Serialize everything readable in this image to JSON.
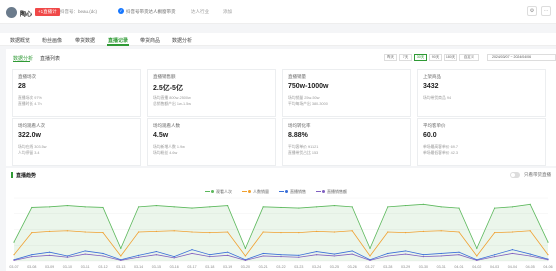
{
  "header": {
    "user_name": "陶心",
    "level_badge": "+1直播计",
    "account": "抖音号：beau.(dc)",
    "verify_text": "抖音号带货达人橱窗带货",
    "industry": "达人行业",
    "follow": "添加",
    "settings_icon": "gear-icon",
    "more_icon": "more-icon",
    "verify_color": "#1677ff",
    "badge_color": "#f04848"
  },
  "tabs": [
    {
      "label": "数据概览",
      "active": false
    },
    {
      "label": "粉丝画像",
      "active": false
    },
    {
      "label": "带货数据",
      "active": false
    },
    {
      "label": "直播记录",
      "active": true
    },
    {
      "label": "带货商品",
      "active": false
    },
    {
      "label": "数据分析",
      "active": false
    }
  ],
  "subtabs": [
    {
      "label": "数据分析",
      "active": true
    },
    {
      "label": "直播列表",
      "active": false
    }
  ],
  "range_buttons": [
    {
      "label": "昨天",
      "active": false
    },
    {
      "label": "7天",
      "active": false
    },
    {
      "label": "30天",
      "active": true
    },
    {
      "label": "90天",
      "active": false
    },
    {
      "label": "180天",
      "active": false
    },
    {
      "label": "自定义",
      "active": false
    }
  ],
  "date_range": "2024/03/07 ~ 2024/04/06",
  "cards": [
    {
      "label": "直播场次",
      "value": "28",
      "sub1": "直播场次 97%",
      "sub2": "直播时长 4.7h"
    },
    {
      "label": "直播销售额",
      "value": "2.5亿-5亿",
      "sub1": "场均直播 800w-2500w",
      "sub2": "总销售额产出 1w-1.5w"
    },
    {
      "label": "直播销量",
      "value": "750w-1000w",
      "sub1": "场均销量 25w-50w",
      "sub2": "平均每场产出 380-3000"
    },
    {
      "label": "上架商品",
      "value": "3432",
      "sub1": "场均带货商品 94",
      "sub2": ""
    },
    {
      "label": "场均观看人次",
      "value": "322.0w",
      "sub1": "场均在线 303.5w",
      "sub2": "人均停留 3.4"
    },
    {
      "label": "场均观看人数",
      "value": "4.5w",
      "sub1": "场均新增人数 1.9w",
      "sub2": "场均粉丝 4.6w"
    },
    {
      "label": "场均转化率",
      "value": "8.88%",
      "sub1": "平均客单价 ¥1121",
      "sub2": "直播带货占比 153"
    },
    {
      "label": "平均客单价",
      "value": "60.0",
      "sub1": "单场最高客单价 69.7",
      "sub2": "单场最低客单价 42.3"
    }
  ],
  "chart_panel": {
    "title": "直播趋势",
    "toggle_label": "只看带货直播",
    "toggle_on": false
  },
  "chart_data": {
    "type": "line",
    "categories": [
      "03-07",
      "03-08",
      "03-09",
      "03-10",
      "03-11",
      "03-12",
      "03-13",
      "03-14",
      "03-15",
      "03-16",
      "03-17",
      "03-18",
      "03-19",
      "03-20",
      "03-21",
      "03-22",
      "03-23",
      "03-24",
      "03-25",
      "03-26",
      "03-27",
      "03-28",
      "03-29",
      "03-30",
      "03-31",
      "04-01",
      "04-02",
      "04-03",
      "04-04",
      "04-05",
      "04-06"
    ],
    "series": [
      {
        "name": "观看人次",
        "color": "#5cb85c",
        "values": [
          30,
          85,
          86,
          88,
          86,
          85,
          20,
          86,
          88,
          86,
          84,
          86,
          88,
          20,
          86,
          85,
          84,
          86,
          88,
          86,
          20,
          86,
          88,
          90,
          86,
          84,
          20,
          84,
          86,
          90,
          30
        ]
      },
      {
        "name": "人数销量",
        "color": "#f0a030",
        "values": [
          10,
          45,
          47,
          48,
          46,
          45,
          8,
          46,
          47,
          48,
          46,
          45,
          46,
          8,
          46,
          45,
          45,
          47,
          46,
          48,
          8,
          46,
          45,
          47,
          48,
          46,
          8,
          45,
          46,
          48,
          10
        ]
      },
      {
        "name": "直播销售",
        "color": "#3a6fd8",
        "values": [
          2,
          10,
          14,
          8,
          16,
          12,
          2,
          9,
          15,
          7,
          18,
          10,
          14,
          2,
          12,
          10,
          9,
          15,
          11,
          16,
          2,
          12,
          16,
          10,
          12,
          14,
          2,
          10,
          18,
          11,
          3
        ]
      },
      {
        "name": "直播销售额",
        "color": "#8060c0",
        "values": [
          1,
          7,
          9,
          6,
          11,
          8,
          1,
          6,
          10,
          5,
          12,
          7,
          9,
          1,
          8,
          7,
          6,
          10,
          8,
          11,
          1,
          8,
          11,
          7,
          8,
          10,
          1,
          7,
          12,
          8,
          2
        ]
      }
    ],
    "ylim": [
      0,
      100
    ]
  }
}
